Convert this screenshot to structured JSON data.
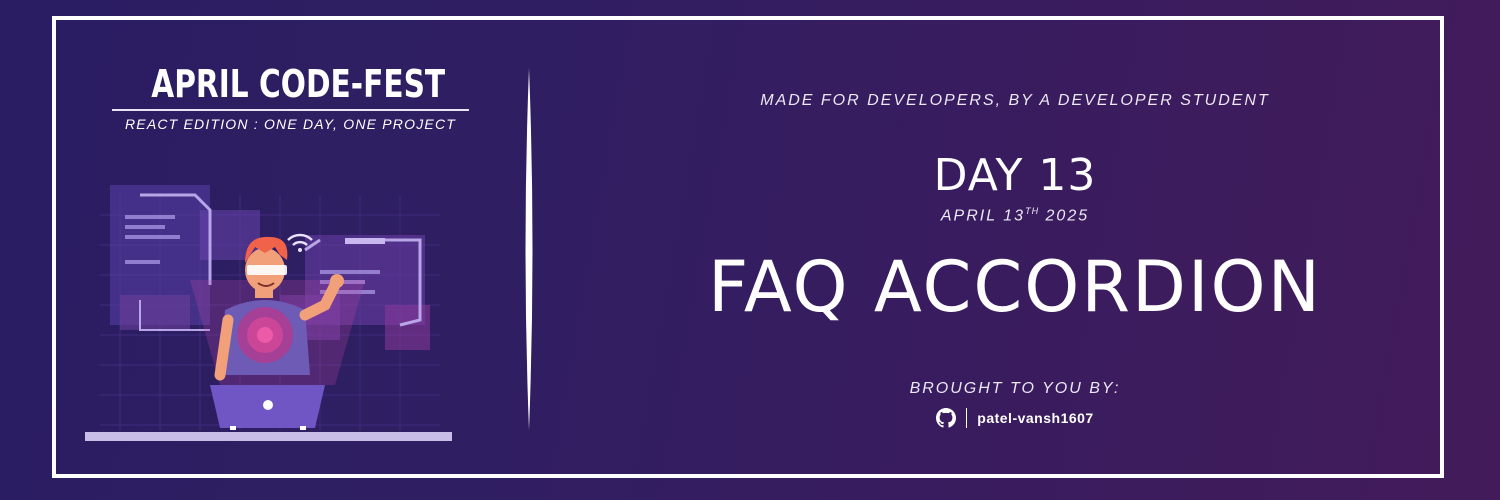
{
  "banner": {
    "event_title": "APRIL CODE-FEST",
    "event_subtitle": "REACT EDITION : ONE DAY, ONE PROJECT",
    "tagline": "MADE FOR DEVELOPERS, BY A DEVELOPER STUDENT",
    "day_label": "DAY 13",
    "date_prefix": "APRIL 13",
    "date_suffix": "TH",
    "date_year": "2025",
    "project_title": "FAQ ACCORDION",
    "credit_label": "BROUGHT TO YOU BY:",
    "github_icon": "github-icon",
    "github_user": "patel-vansh1607"
  },
  "colors": {
    "background_start": "#2a1d63",
    "background_end": "#431b5a",
    "frame": "#ffffff",
    "accent_pink": "#e0448a",
    "hair_orange": "#f0624a"
  }
}
